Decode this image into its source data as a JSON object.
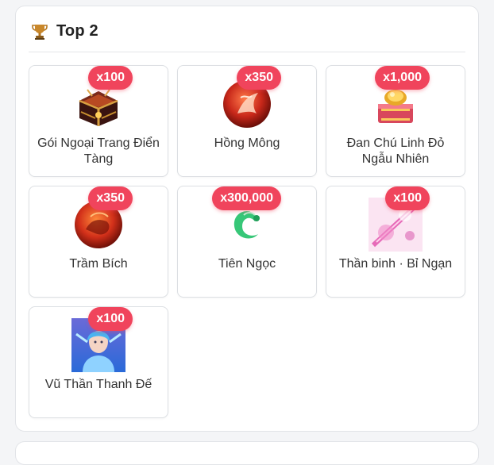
{
  "section": {
    "title": "Top 2",
    "icon": "trophy-icon"
  },
  "items": [
    {
      "name": "Gói Ngoại Trang Điển Tàng",
      "qty": "x100",
      "icon": "chest-icon"
    },
    {
      "name": "Hồng Mông",
      "qty": "x350",
      "icon": "red-orb-icon"
    },
    {
      "name": "Đan Chú Linh Đỏ Ngẫu Nhiên",
      "qty": "x1,000",
      "icon": "gold-box-icon"
    },
    {
      "name": "Trầm Bích",
      "qty": "x350",
      "icon": "red-orb-icon"
    },
    {
      "name": "Tiên Ngọc",
      "qty": "x300,000",
      "icon": "jade-icon"
    },
    {
      "name": "Thần binh · Bỉ Ngạn",
      "qty": "x100",
      "icon": "pink-weapon-icon"
    },
    {
      "name": "Vũ Thần Thanh Đế",
      "qty": "x100",
      "icon": "portrait-icon"
    }
  ]
}
